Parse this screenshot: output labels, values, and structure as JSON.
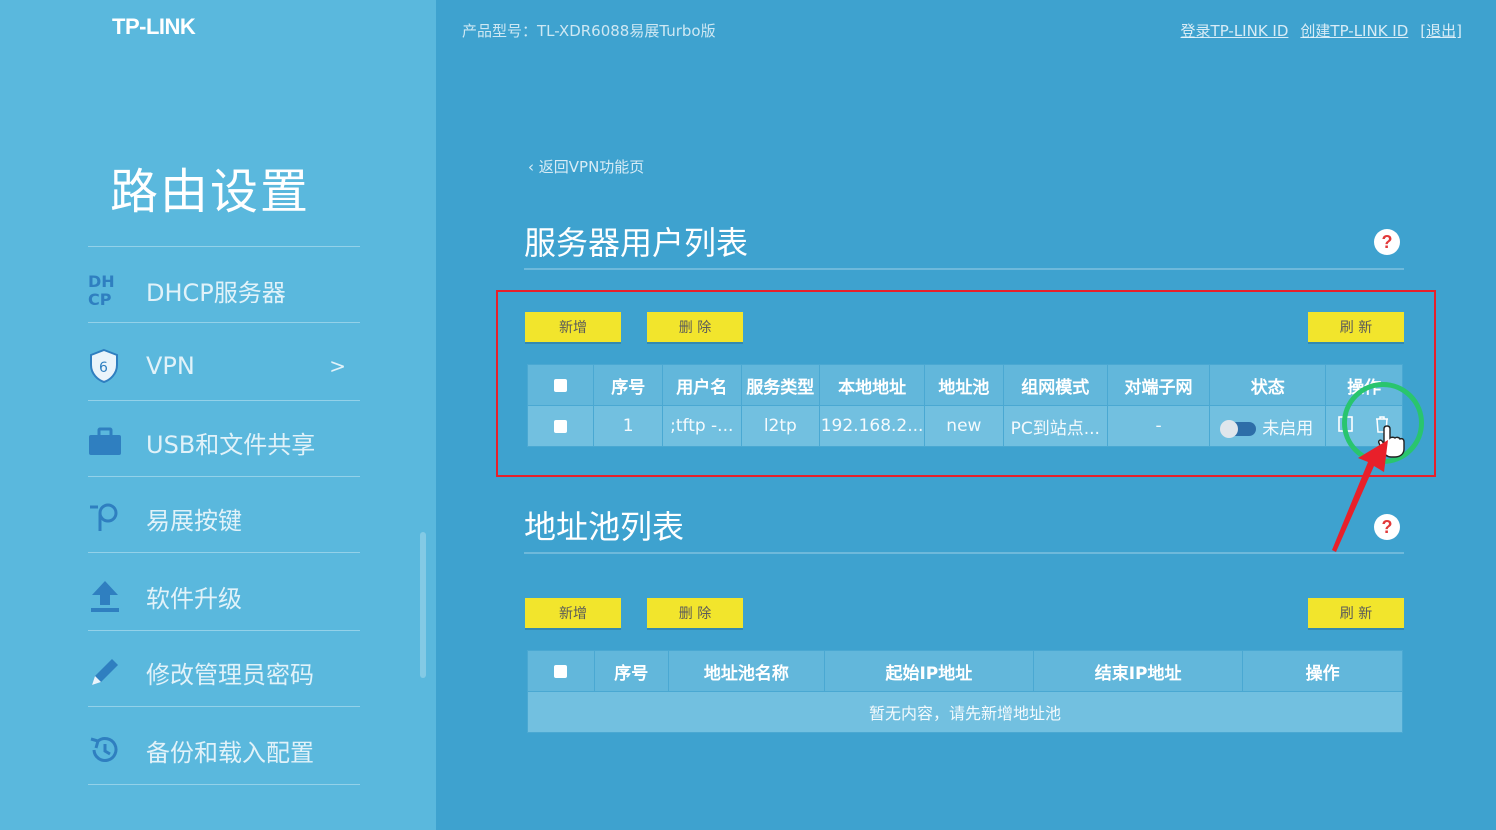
{
  "brand": {
    "logo": "TP-LINK"
  },
  "header": {
    "model_text": "产品型号：TL-XDR6088易展Turbo版",
    "links": [
      "登录TP-LINK ID",
      "创建TP-LINK ID",
      "[退出]"
    ]
  },
  "sidebar": {
    "title": "路由设置",
    "items": [
      {
        "label": "DHCP服务器",
        "icon": "dhcp-icon"
      },
      {
        "label": "VPN",
        "icon": "shield-icon",
        "chevron": ">"
      },
      {
        "label": "USB和文件共享",
        "icon": "briefcase-icon"
      },
      {
        "label": "易展按键",
        "icon": "easymesh-icon"
      },
      {
        "label": "软件升级",
        "icon": "upload-icon"
      },
      {
        "label": "修改管理员密码",
        "icon": "pencil-icon"
      },
      {
        "label": "备份和载入配置",
        "icon": "history-icon"
      }
    ]
  },
  "main": {
    "back_label": "返回VPN功能页",
    "user_list": {
      "title": "服务器用户列表",
      "buttons": {
        "add": "新增",
        "delete": "删 除",
        "refresh": "刷 新"
      },
      "columns": [
        "序号",
        "用户名",
        "服务类型",
        "本地地址",
        "地址池",
        "组网模式",
        "对端子网",
        "状态",
        "操作"
      ],
      "rows": [
        {
          "index": "1",
          "username": ";tftp -...",
          "service": "l2tp",
          "local_addr": "192.168.2...",
          "pool": "new",
          "mode": "PC到站点...",
          "peer_subnet": "-",
          "status": "未启用"
        }
      ]
    },
    "pool_list": {
      "title": "地址池列表",
      "buttons": {
        "add": "新增",
        "delete": "删 除",
        "refresh": "刷 新"
      },
      "columns": [
        "序号",
        "地址池名称",
        "起始IP地址",
        "结束IP地址",
        "操作"
      ],
      "empty_text": "暂无内容，请先新增地址池"
    },
    "help_symbol": "?"
  },
  "colors": {
    "background": "#3ea2cf",
    "sidebar": "#5ab8dd",
    "button": "#f2e52c",
    "highlight_box": "#e8202a",
    "highlight_ring": "#29c56e"
  }
}
